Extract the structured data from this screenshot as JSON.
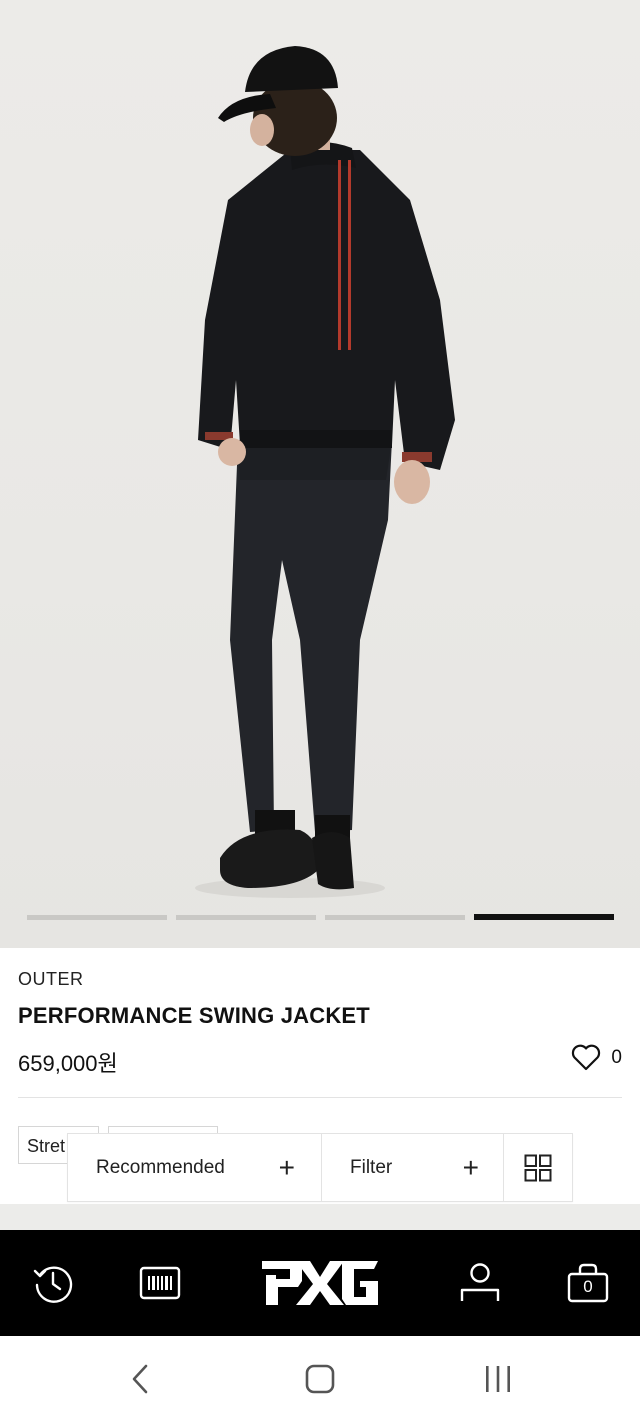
{
  "gallery": {
    "image_alt": "Model wearing black performance swing jacket, back view",
    "slide_count": 4,
    "active_slide": 4
  },
  "product": {
    "category": "OUTER",
    "name": "PERFORMANCE SWING JACKET",
    "price": "659,000원",
    "like_count": "0"
  },
  "chips": [
    "Stret",
    ""
  ],
  "sortbar": {
    "recommended_label": "Recommended",
    "filter_label": "Filter"
  },
  "appnav": {
    "cart_count": "0",
    "logo": "PXG"
  },
  "colors": {
    "nav_bg": "#000000",
    "accent_stripe": "#b33a2c",
    "indicator_active": "#111111",
    "indicator_inactive": "#c9c8c5"
  }
}
